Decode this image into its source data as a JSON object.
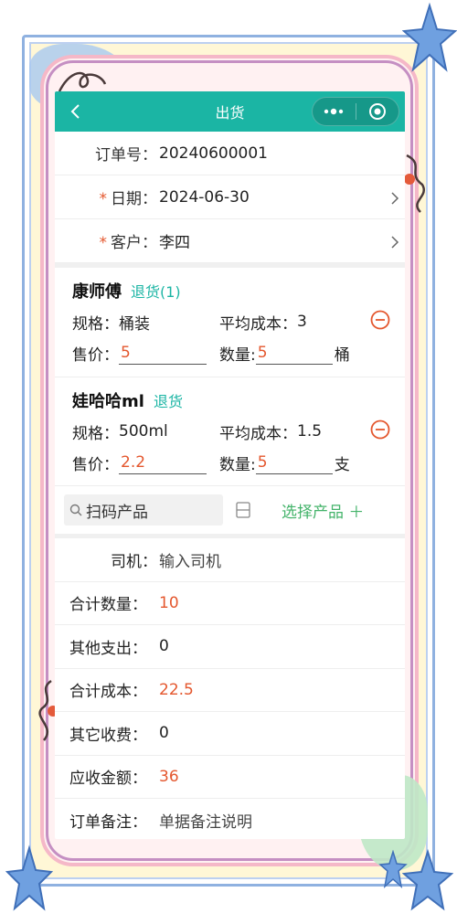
{
  "nav": {
    "title": "出货"
  },
  "order": {
    "no_label": "订单号：",
    "no_value": "20240600001",
    "date_required": "*",
    "date_label": "日期：",
    "date_value": "2024-06-30",
    "customer_required": "*",
    "customer_label": "客户：",
    "customer_value": "李四"
  },
  "products": [
    {
      "name": "康师傅",
      "return_label": "退货(1)",
      "spec_label": "规格：",
      "spec_value": "桶装",
      "cost_label": "平均成本：",
      "cost_value": "3",
      "price_label": "售价：",
      "price_value": "5",
      "qty_label": "数量:",
      "qty_value": "5",
      "unit": "桶"
    },
    {
      "name": "娃哈哈ml",
      "return_label": "退货",
      "spec_label": "规格：",
      "spec_value": "500ml",
      "cost_label": "平均成本：",
      "cost_value": "1.5",
      "price_label": "售价：",
      "price_value": "2.2",
      "qty_label": "数量:",
      "qty_value": "5",
      "unit": "支"
    }
  ],
  "scan": {
    "label": "扫码产品",
    "select_label": "选择产品 ＋"
  },
  "summary": {
    "driver_label": "司机：",
    "driver_placeholder": "输入司机",
    "total_qty_label": "合计数量：",
    "total_qty_value": "10",
    "other_exp_label": "其他支出：",
    "other_exp_value": "0",
    "total_cost_label": "合计成本：",
    "total_cost_value": "22.5",
    "other_fee_label": "其它收费：",
    "other_fee_value": "0",
    "receivable_label": "应收金额：",
    "receivable_value": "36",
    "remark_label": "订单备注：",
    "remark_placeholder": "单据备注说明"
  },
  "colors": {
    "nav_bg": "#1bb5a4",
    "accent_orange": "#e4572e",
    "return_teal": "#1bb5a4",
    "select_green": "#43b36a"
  },
  "icons": [
    "back-icon",
    "more-dots-icon",
    "target-icon",
    "chevron-right-icon",
    "minus-circle-icon",
    "search-icon",
    "scan-icon",
    "plus-icon"
  ]
}
